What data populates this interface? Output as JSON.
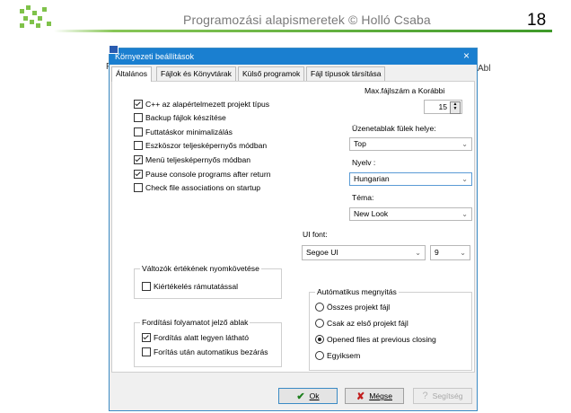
{
  "slide": {
    "title": "Programozási alapismeretek © Holló Csaba",
    "number": "18"
  },
  "background_window": {
    "left_menu_fragment": "Fá",
    "right_menu_fragment": "Abl"
  },
  "dialog": {
    "title": "Környezeti beállítások",
    "close_glyph": "×",
    "tabs": [
      {
        "label": "Általános",
        "active": true
      },
      {
        "label": "Fájlok és Könyvtárak",
        "active": false
      },
      {
        "label": "Külső programok",
        "active": false
      },
      {
        "label": "Fájl típusok társítása",
        "active": false
      }
    ],
    "options": [
      {
        "label": "C++ az alapértelmezett projekt típus",
        "checked": true
      },
      {
        "label": "Backup fájlok készítése",
        "checked": false
      },
      {
        "label": "Futtatáskor minimalizálás",
        "checked": false
      },
      {
        "label": "Eszköszor teljesképernyős módban",
        "checked": false
      },
      {
        "label": "Menü teljesképernyős módban",
        "checked": true
      },
      {
        "label": "Pause console programs after return",
        "checked": true
      },
      {
        "label": "Check file associations on startup",
        "checked": false
      }
    ],
    "max_files": {
      "label": "Max.fájlszám a Korábbi",
      "value": "15"
    },
    "tab_position": {
      "label": "Üzenetablak fülek helye:",
      "value": "Top"
    },
    "language": {
      "label": "Nyelv :",
      "value": "Hungarian"
    },
    "theme": {
      "label": "Téma:",
      "value": "New Look"
    },
    "ui_font": {
      "label": "UI font:",
      "value": "Segoe UI",
      "size": "9"
    },
    "variable_tracking": {
      "title": "Változók értékének nyomkövetése",
      "option": {
        "label": "Kiértékelés rámutatással",
        "checked": false
      }
    },
    "compile_progress": {
      "title": "Fordítási folyamatot jelző ablak",
      "options": [
        {
          "label": "Fordítás alatt legyen látható",
          "checked": true
        },
        {
          "label": "Forítás után automatikus bezárás",
          "checked": false
        }
      ]
    },
    "auto_open": {
      "title": "Autómatikus megnyitás",
      "options": [
        {
          "label": "Összes projekt fájl",
          "checked": false
        },
        {
          "label": "Csak az első projekt fájl",
          "checked": false
        },
        {
          "label": "Opened files at previous closing",
          "checked": true
        },
        {
          "label": "Egyiksem",
          "checked": false
        }
      ]
    },
    "buttons": {
      "ok_label": "Ok",
      "cancel_label": "Mégse",
      "help_label": "Segítség"
    },
    "colors": {
      "title_bar": "#1a7fd0",
      "header_line": "#3f9a2a"
    }
  }
}
